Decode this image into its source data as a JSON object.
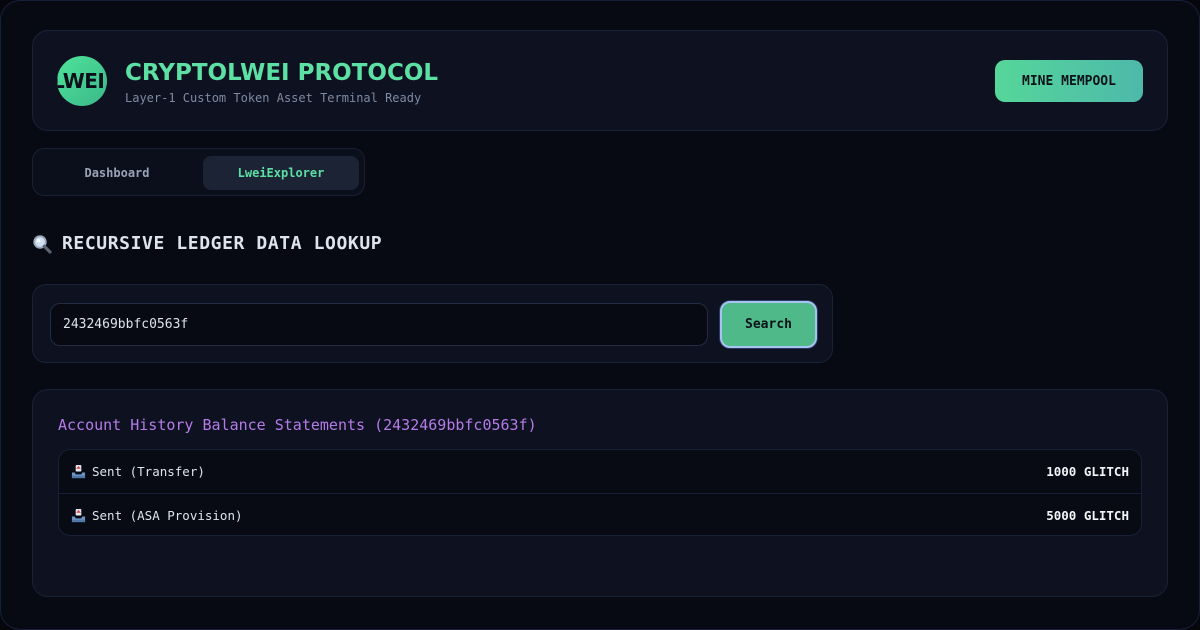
{
  "header": {
    "logo_text": "LWEI",
    "title": "CRYPTOLWEI PROTOCOL",
    "subtitle": "Layer-1 Custom Token Asset Terminal Ready",
    "mine_button_label": "MINE MEMPOOL"
  },
  "tabs": [
    {
      "label": "Dashboard",
      "active": false
    },
    {
      "label": "LweiExplorer",
      "active": true
    }
  ],
  "section": {
    "icon": "magnifier-icon",
    "title": "RECURSIVE LEDGER DATA LOOKUP"
  },
  "search": {
    "value": "2432469bbfc0563f",
    "button_label": "Search"
  },
  "history": {
    "title": "Account History Balance Statements (2432469bbfc0563f)",
    "rows": [
      {
        "icon": "outbox-tray-icon",
        "label": "Sent (Transfer)",
        "amount": "1000 GLITCH"
      },
      {
        "icon": "outbox-tray-icon",
        "label": "Sent (ASA Provision)",
        "amount": "5000 GLITCH"
      }
    ]
  },
  "colors": {
    "accent_green": "#5ce0a3",
    "accent_purple": "#b57ce8",
    "background": "#070a13",
    "card": "#0d1120"
  }
}
